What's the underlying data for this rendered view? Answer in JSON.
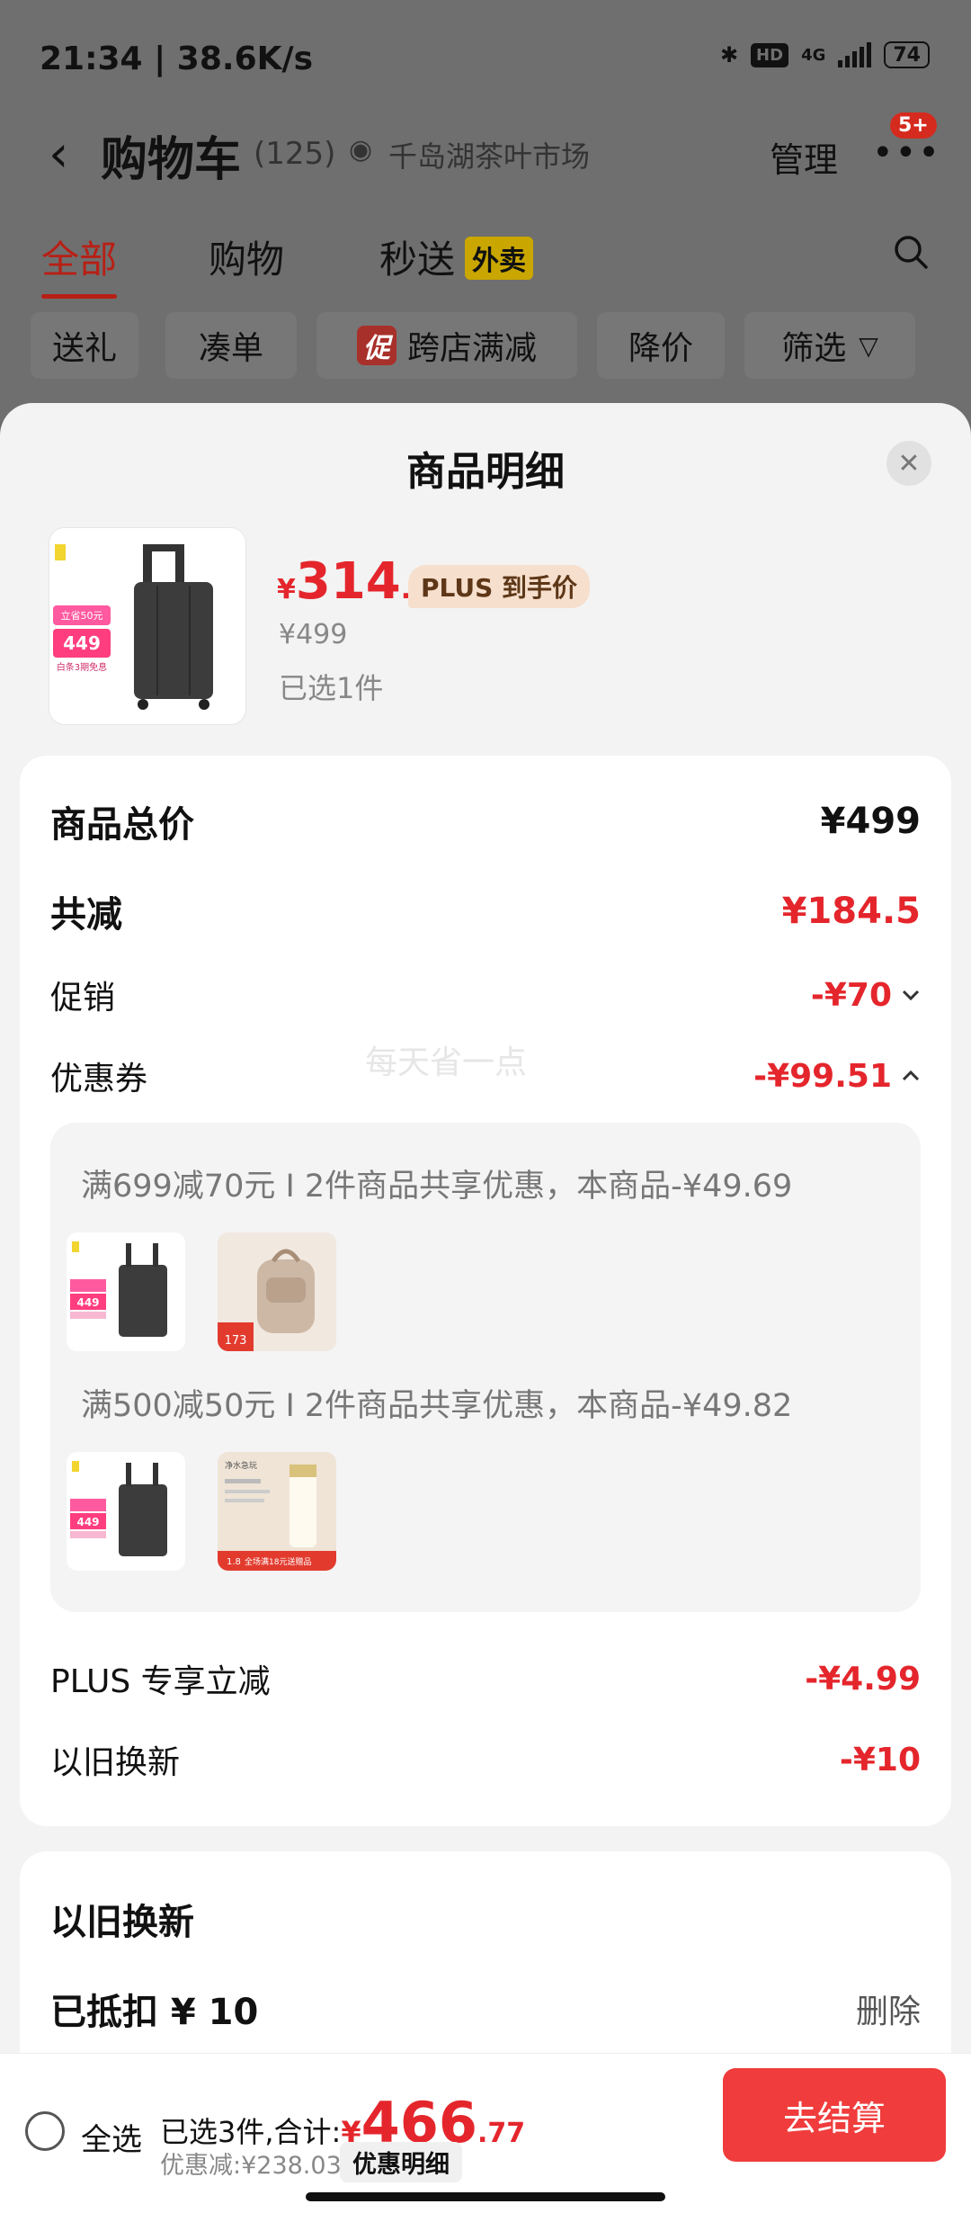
{
  "status_bar": {
    "time_speed": "21:34 | 38.6K/s",
    "network": "4G",
    "hd": "HD",
    "battery": "74"
  },
  "nav": {
    "back_icon": "chevron-left-icon",
    "title": "购物车",
    "count": "(125)",
    "store": "千岛湖茶叶市场",
    "manage": "管理",
    "badge": "5+"
  },
  "tabs": [
    {
      "label": "全部"
    },
    {
      "label": "购物"
    },
    {
      "label": "秒送"
    }
  ],
  "waimai": "外卖",
  "filters": {
    "gift": "送礼",
    "combine": "凑单",
    "cu": "促",
    "cross_store": "跨店满减",
    "price_drop": "降价",
    "filter": "筛选"
  },
  "sheet": {
    "title": "商品明细",
    "product": {
      "price_symbol": "¥",
      "price_int": "314",
      "price_dec": ".5",
      "plus_tag": "PLUS 到手价",
      "orig_price": "¥499",
      "selected": "已选1件"
    },
    "summary": {
      "total_label": "商品总价",
      "total_value": "¥499",
      "reduce_label": "共减",
      "reduce_value": "¥184.5",
      "promo_label": "促销",
      "promo_value": "-¥70",
      "coupon_label": "优惠券",
      "coupon_value": "-¥99.51",
      "watermark": "每天省一点",
      "coupons": [
        {
          "text": "满699减70元 I 2件商品共享优惠，本商品-¥49.69"
        },
        {
          "text": "满500减50元 I 2件商品共享优惠，本商品-¥49.82"
        }
      ],
      "plus_label": "PLUS 专享立减",
      "plus_value": "-¥4.99",
      "tradein_label": "以旧换新",
      "tradein_value": "-¥10"
    },
    "tradein_card": {
      "title": "以旧换新",
      "deducted": "已抵扣 ¥ 10",
      "delete": "删除"
    }
  },
  "bottom": {
    "select_all": "全选",
    "selected_sum": "已选3件,合计:",
    "yen": "¥",
    "total_int": "466",
    "total_dec": ".77",
    "discount": "优惠减:¥238.03",
    "detail_btn": "优惠明细",
    "checkout": "去结算"
  },
  "thumb_text": {
    "coupon_tag": "立省50元",
    "price": "449",
    "install": "白条3期免息",
    "bag_price": "173",
    "cream_brand": "净水急玩",
    "cream_promo": "全场满18元送赠品",
    "cream_price": "1.8"
  }
}
